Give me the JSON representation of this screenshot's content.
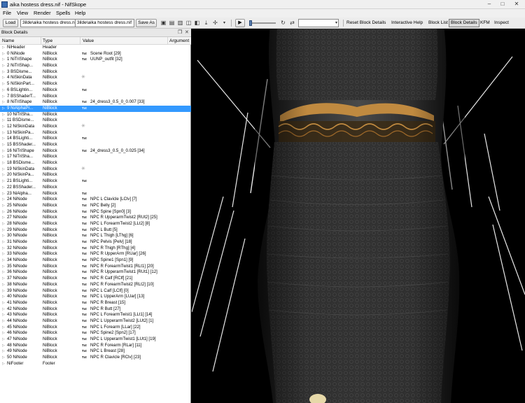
{
  "window": {
    "title": "aika hostess dress.nif - NifSkope",
    "minimize": "–",
    "maximize": "□",
    "close": "✕"
  },
  "menu": [
    "File",
    "View",
    "Render",
    "Spells",
    "Help"
  ],
  "toolbar": {
    "load_label": "Load",
    "load_path": "3ilde\\aika hostess dress.nif",
    "save_path": "3ilde\\aika hostess dress.nif",
    "saveas_label": "Save As",
    "actions": [
      "Reset Block Details",
      "Interactive Help",
      "Block List",
      "Block Details",
      "KFM",
      "Inspect"
    ],
    "active_action": "Block Details"
  },
  "dock": {
    "title": "Block Details",
    "float": "❐",
    "close": "✕"
  },
  "columns": [
    "Name",
    "Type",
    "Value",
    "Argument"
  ],
  "rows": [
    {
      "name": "NiHeader",
      "type": "Header",
      "kind": ""
    },
    {
      "name": "0 NiNode",
      "type": "NiBlock",
      "kind": "txt",
      "value": "Scene Root [29]"
    },
    {
      "name": "1 NiTriShape",
      "type": "NiBlock",
      "kind": "txt",
      "value": "UUNP_outfit [32]"
    },
    {
      "name": "2 NiTriShap...",
      "type": "NiBlock",
      "kind": ""
    },
    {
      "name": "3 BSDisme...",
      "type": "NiBlock",
      "kind": ""
    },
    {
      "name": "4 NiSkinData",
      "type": "NiBlock",
      "kind": "spin"
    },
    {
      "name": "5 NiSkinPart...",
      "type": "NiBlock",
      "kind": ""
    },
    {
      "name": "6 BSLightin...",
      "type": "NiBlock",
      "kind": "txt",
      "value": ""
    },
    {
      "name": "7 BSShaderT...",
      "type": "NiBlock",
      "kind": ""
    },
    {
      "name": "8 NiTriShape",
      "type": "NiBlock",
      "kind": "txt",
      "value": "24_dress3_0.5_0_0.007 [33]"
    },
    {
      "name": "9 NiAlphaPr...",
      "type": "NiBlock",
      "kind": "txt",
      "value": "",
      "selected": true
    },
    {
      "name": "10 NiTriSha...",
      "type": "NiBlock",
      "kind": ""
    },
    {
      "name": "11 BSDisme...",
      "type": "NiBlock",
      "kind": ""
    },
    {
      "name": "12 NiSkinData",
      "type": "NiBlock",
      "kind": "spin"
    },
    {
      "name": "13 NiSkinPa...",
      "type": "NiBlock",
      "kind": ""
    },
    {
      "name": "14 BSLighti...",
      "type": "NiBlock",
      "kind": "txt",
      "value": ""
    },
    {
      "name": "15 BSShader...",
      "type": "NiBlock",
      "kind": ""
    },
    {
      "name": "16 NiTriShape",
      "type": "NiBlock",
      "kind": "txt",
      "value": "24_dress3_0.5_0_0.025 [34]"
    },
    {
      "name": "17 NiTriSha...",
      "type": "NiBlock",
      "kind": ""
    },
    {
      "name": "18 BSDisme...",
      "type": "NiBlock",
      "kind": ""
    },
    {
      "name": "19 NiSkinData",
      "type": "NiBlock",
      "kind": "spin"
    },
    {
      "name": "20 NiSkinPa...",
      "type": "NiBlock",
      "kind": ""
    },
    {
      "name": "21 BSLighti...",
      "type": "NiBlock",
      "kind": "txt",
      "value": ""
    },
    {
      "name": "22 BSShader...",
      "type": "NiBlock",
      "kind": ""
    },
    {
      "name": "23 NiAlpha...",
      "type": "NiBlock",
      "kind": "txt",
      "value": ""
    },
    {
      "name": "24 NiNode",
      "type": "NiBlock",
      "kind": "txt",
      "value": "NPC L Clavicle [LClv] [7]"
    },
    {
      "name": "25 NiNode",
      "type": "NiBlock",
      "kind": "txt",
      "value": "NPC Belly [2]"
    },
    {
      "name": "26 NiNode",
      "type": "NiBlock",
      "kind": "txt",
      "value": "NPC Spine [Spn0] [3]"
    },
    {
      "name": "27 NiNode",
      "type": "NiBlock",
      "kind": "txt",
      "value": "NPC R UpperarmTwist2 [RUt2] [25]"
    },
    {
      "name": "28 NiNode",
      "type": "NiBlock",
      "kind": "txt",
      "value": "NPC L ForearmTwist2 [LLt2] [8]"
    },
    {
      "name": "29 NiNode",
      "type": "NiBlock",
      "kind": "txt",
      "value": "NPC L Butt [5]"
    },
    {
      "name": "30 NiNode",
      "type": "NiBlock",
      "kind": "txt",
      "value": "NPC L Thigh [LThg] [6]"
    },
    {
      "name": "31 NiNode",
      "type": "NiBlock",
      "kind": "txt",
      "value": "NPC Pelvis [Pelv] [18]"
    },
    {
      "name": "32 NiNode",
      "type": "NiBlock",
      "kind": "txt",
      "value": "NPC R Thigh [RThg] [4]"
    },
    {
      "name": "33 NiNode",
      "type": "NiBlock",
      "kind": "txt",
      "value": "NPC R UpperArm [RUar] [26]"
    },
    {
      "name": "34 NiNode",
      "type": "NiBlock",
      "kind": "txt",
      "value": "NPC Spine1 [Spn1] [9]"
    },
    {
      "name": "35 NiNode",
      "type": "NiBlock",
      "kind": "txt",
      "value": "NPC R ForearmTwist1 [RLt1] [20]"
    },
    {
      "name": "36 NiNode",
      "type": "NiBlock",
      "kind": "txt",
      "value": "NPC R UpperarmTwist1 [RUt1] [12]"
    },
    {
      "name": "37 NiNode",
      "type": "NiBlock",
      "kind": "txt",
      "value": "NPC R Calf [RClf] [21]"
    },
    {
      "name": "38 NiNode",
      "type": "NiBlock",
      "kind": "txt",
      "value": "NPC R ForearmTwist2 [RLt2] [10]"
    },
    {
      "name": "39 NiNode",
      "type": "NiBlock",
      "kind": "txt",
      "value": "NPC L Calf [LClf] [0]"
    },
    {
      "name": "40 NiNode",
      "type": "NiBlock",
      "kind": "txt",
      "value": "NPC L UpperArm [LUar] [13]"
    },
    {
      "name": "41 NiNode",
      "type": "NiBlock",
      "kind": "txt",
      "value": "NPC R Breast [15]"
    },
    {
      "name": "42 NiNode",
      "type": "NiBlock",
      "kind": "txt",
      "value": "NPC R Butt [27]"
    },
    {
      "name": "43 NiNode",
      "type": "NiBlock",
      "kind": "txt",
      "value": "NPC L ForearmTwist1 [LLt1] [14]"
    },
    {
      "name": "44 NiNode",
      "type": "NiBlock",
      "kind": "txt",
      "value": "NPC L UpperarmTwist2 [LUt2] [1]"
    },
    {
      "name": "45 NiNode",
      "type": "NiBlock",
      "kind": "txt",
      "value": "NPC L Forearm [LLar] [22]"
    },
    {
      "name": "46 NiNode",
      "type": "NiBlock",
      "kind": "txt",
      "value": "NPC Spine2 [Spn2] [17]"
    },
    {
      "name": "47 NiNode",
      "type": "NiBlock",
      "kind": "txt",
      "value": "NPC L UpperarmTwist1 [LUt1] [19]"
    },
    {
      "name": "48 NiNode",
      "type": "NiBlock",
      "kind": "txt",
      "value": "NPC R Forearm [RLar] [11]"
    },
    {
      "name": "49 NiNode",
      "type": "NiBlock",
      "kind": "txt",
      "value": "NPC L Breast [28]"
    },
    {
      "name": "50 NiNode",
      "type": "NiBlock",
      "kind": "txt",
      "value": "NPC R Clavicle [RClv] [23]"
    },
    {
      "name": "NiFooter",
      "type": "Footer",
      "kind": ""
    }
  ],
  "txt_badge": "Txt",
  "colors": {
    "selection": "#3399ff",
    "viewport_bg": "#000000",
    "dress": "#3a3a3a",
    "lace": "#c08a40"
  }
}
